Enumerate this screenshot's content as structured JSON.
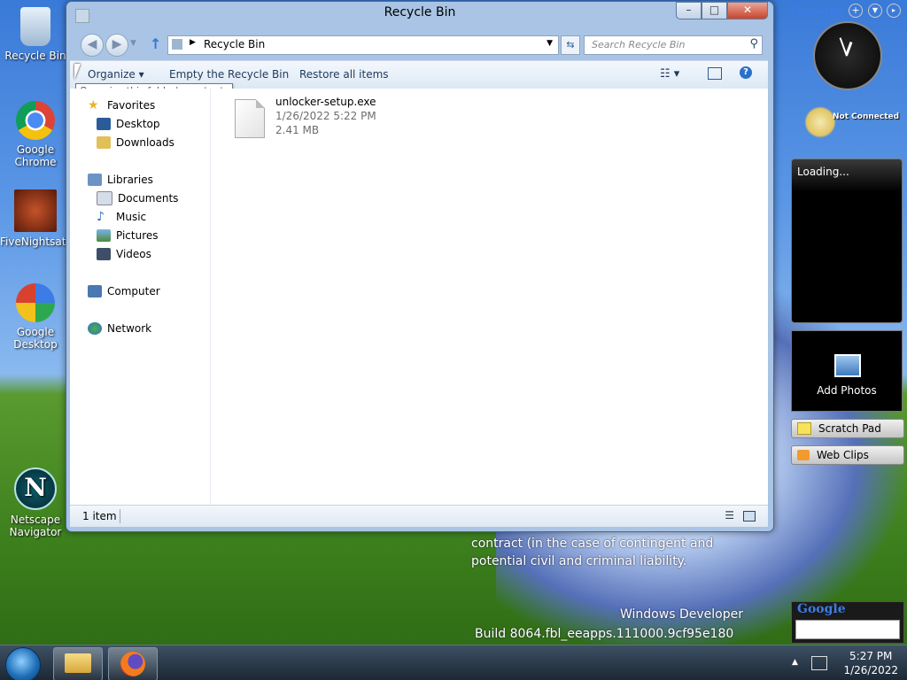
{
  "desktop": {
    "icons": [
      {
        "label": "Recycle Bin"
      },
      {
        "label": "Google Chrome"
      },
      {
        "label": "FiveNightsat..."
      },
      {
        "label": "Google Desktop"
      },
      {
        "label": "Netscape Navigator"
      }
    ],
    "watermark": {
      "line1": "contract (in the case of contingent and",
      "line2": "potential civil and criminal liability.",
      "line3": "Windows Developer",
      "line4": "Build 8064.fbl_eeapps.111000.9cf95e180"
    }
  },
  "window": {
    "title": "Recycle Bin",
    "address": "Recycle Bin",
    "search_placeholder": "Search Recycle Bin",
    "toolbar": {
      "organize": "Organize",
      "empty": "Empty the Recycle Bin",
      "restore": "Restore all items"
    },
    "tooltip": "Organize this folder's contents",
    "nav": {
      "favorites": "Favorites",
      "desktop": "Desktop",
      "downloads": "Downloads",
      "libraries": "Libraries",
      "documents": "Documents",
      "music": "Music",
      "pictures": "Pictures",
      "videos": "Videos",
      "computer": "Computer",
      "network": "Network"
    },
    "file": {
      "name": "unlocker-setup.exe",
      "date": "1/26/2022 5:22 PM",
      "size": "2.41 MB"
    },
    "status": "1 item"
  },
  "gadgets": {
    "google_brand": "Google",
    "not_connected": "Not Connected",
    "loading": "Loading...",
    "add_photos": "Add Photos",
    "scratch_pad": "Scratch Pad",
    "web_clips": "Web Clips",
    "google_search_brand": "Google"
  },
  "taskbar": {
    "time": "5:27 PM",
    "date": "1/26/2022"
  }
}
